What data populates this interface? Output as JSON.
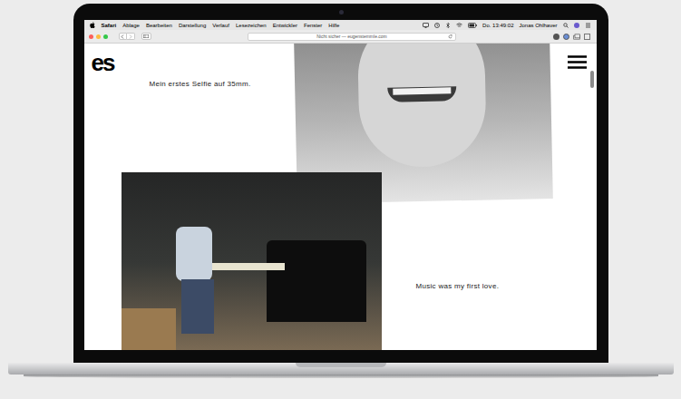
{
  "menu_bar": {
    "items": [
      "Safari",
      "Ablage",
      "Bearbeiten",
      "Darstellung",
      "Verlauf",
      "Lesezeichen",
      "Entwickler",
      "Fenster",
      "Hilfe"
    ],
    "clock": "Do. 13:49:02",
    "user": "Jonas Ohlhaver"
  },
  "toolbar": {
    "address": "Nicht sicher — eugenstemmle.com"
  },
  "page": {
    "logo": "es",
    "captions": [
      "Mein erstes Selfie auf 35mm.",
      "Music was my first love."
    ]
  }
}
